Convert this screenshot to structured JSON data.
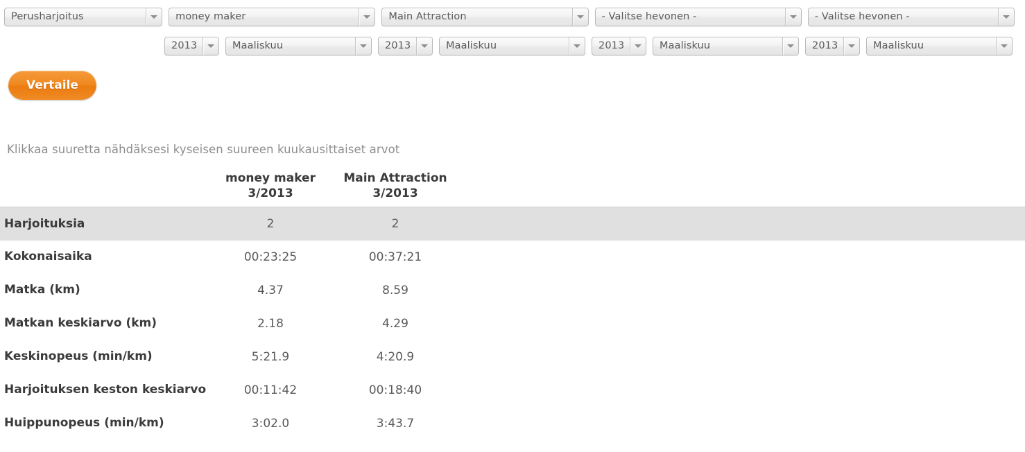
{
  "filters": {
    "row1": [
      {
        "name": "training-type",
        "value": "Perusharjoitus",
        "width": "w-type"
      },
      {
        "name": "horse-1",
        "value": "money maker",
        "width": "w-horse"
      },
      {
        "name": "horse-2",
        "value": "Main Attraction",
        "width": "w-horse"
      },
      {
        "name": "horse-3",
        "value": "- Valitse hevonen -",
        "width": "w-horse"
      },
      {
        "name": "horse-4",
        "value": "- Valitse hevonen -",
        "width": "w-horse"
      }
    ],
    "row2": [
      {
        "name": "year-1",
        "value": "2013",
        "width": "w-year"
      },
      {
        "name": "month-1",
        "value": "Maaliskuu",
        "width": "w-month"
      },
      {
        "name": "year-2",
        "value": "2013",
        "width": "w-year"
      },
      {
        "name": "month-2",
        "value": "Maaliskuu",
        "width": "w-month"
      },
      {
        "name": "year-3",
        "value": "2013",
        "width": "w-year"
      },
      {
        "name": "month-3",
        "value": "Maaliskuu",
        "width": "w-month"
      },
      {
        "name": "year-4",
        "value": "2013",
        "width": "w-year"
      },
      {
        "name": "month-4",
        "value": "Maaliskuu",
        "width": "w-month"
      }
    ]
  },
  "compare_button": {
    "label": "Vertaile",
    "color": "#ef8a24"
  },
  "hint": "Klikkaa suuretta nähdäksesi kyseisen suureen kuukausittaiset arvot",
  "table": {
    "header": {
      "label_col": "",
      "columns": [
        {
          "name": "money maker",
          "period": "3/2013"
        },
        {
          "name": "Main Attraction",
          "period": "3/2013"
        }
      ]
    },
    "rows": [
      {
        "label": "Harjoituksia",
        "values": [
          "2",
          "2"
        ],
        "shaded": true
      },
      {
        "label": "Kokonaisaika",
        "values": [
          "00:23:25",
          "00:37:21"
        ],
        "shaded": false
      },
      {
        "label": "Matka (km)",
        "values": [
          "4.37",
          "8.59"
        ],
        "shaded": false
      },
      {
        "label": "Matkan keskiarvo (km)",
        "values": [
          "2.18",
          "4.29"
        ],
        "shaded": false
      },
      {
        "label": "Keskinopeus (min/km)",
        "values": [
          "5:21.9",
          "4:20.9"
        ],
        "shaded": false
      },
      {
        "label": "Harjoituksen keston keskiarvo",
        "values": [
          "00:11:42",
          "00:18:40"
        ],
        "shaded": false
      },
      {
        "label": "Huippunopeus (min/km)",
        "values": [
          "3:02.0",
          "3:43.7"
        ],
        "shaded": false
      }
    ]
  }
}
